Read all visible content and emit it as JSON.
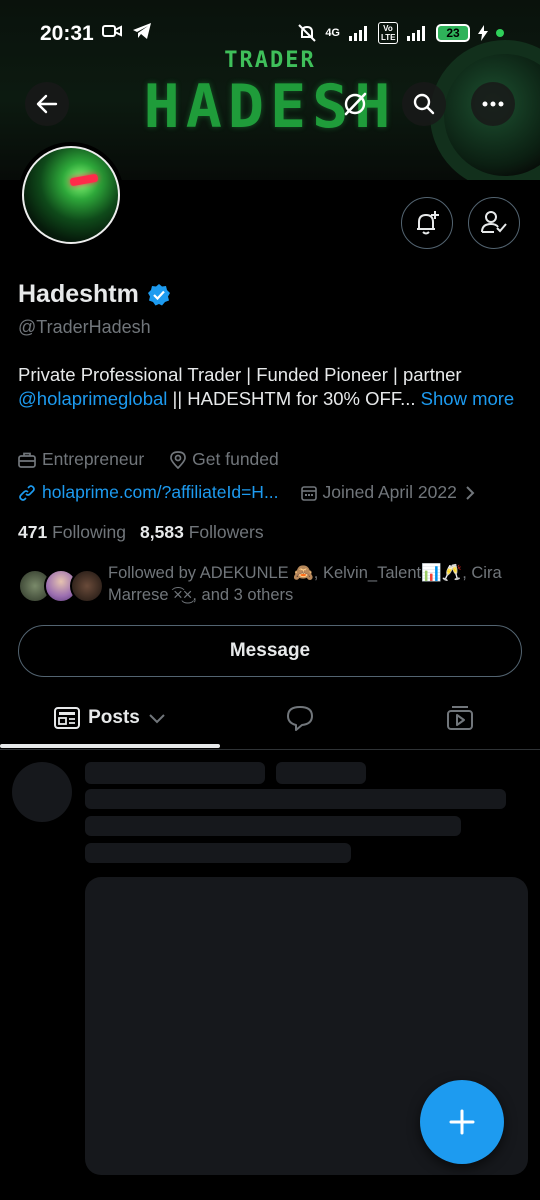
{
  "status_bar": {
    "time": "20:31",
    "network": "4G",
    "volte": "Vo LTE",
    "battery": "23"
  },
  "banner": {
    "subtitle": "TRADER",
    "title": "HADESH"
  },
  "profile": {
    "name": "Hadeshtm",
    "handle": "@TraderHadesh",
    "bio_text": "Private Professional Trader | Funded Pioneer | partner",
    "bio_mention": "@holaprimeglobal",
    "bio_rest": " || HADESHTM for 30% OFF...",
    "bio_show_more": "Show more",
    "category": "Entrepreneur",
    "location": "Get funded",
    "website": "holaprime.com/?affiliateId=H...",
    "joined": "Joined April 2022",
    "following_count": "471",
    "following_label": "Following",
    "followers_count": "8,583",
    "followers_label": "Followers",
    "followed_by_1": "Followed by ADEKUNLE 🙈, Kelvin_Talent📊🥂, Cira",
    "followed_by_2": "Marrese ͡×͜×, and 3 others"
  },
  "actions": {
    "message_label": "Message"
  },
  "tabs": {
    "posts_label": "Posts"
  },
  "colors": {
    "accent": "#1d9bf0",
    "verified": "#1d9bf0",
    "muted": "#71767b",
    "border": "#536471"
  },
  "icons": [
    "back-arrow-icon",
    "grok-icon",
    "search-icon",
    "more-icon",
    "notification-add-icon",
    "follow-user-icon",
    "verified-badge-icon",
    "briefcase-icon",
    "location-icon",
    "link-icon",
    "calendar-icon",
    "chevron-right-icon",
    "posts-icon",
    "chevron-down-icon",
    "replies-icon",
    "media-icon",
    "plus-icon"
  ]
}
